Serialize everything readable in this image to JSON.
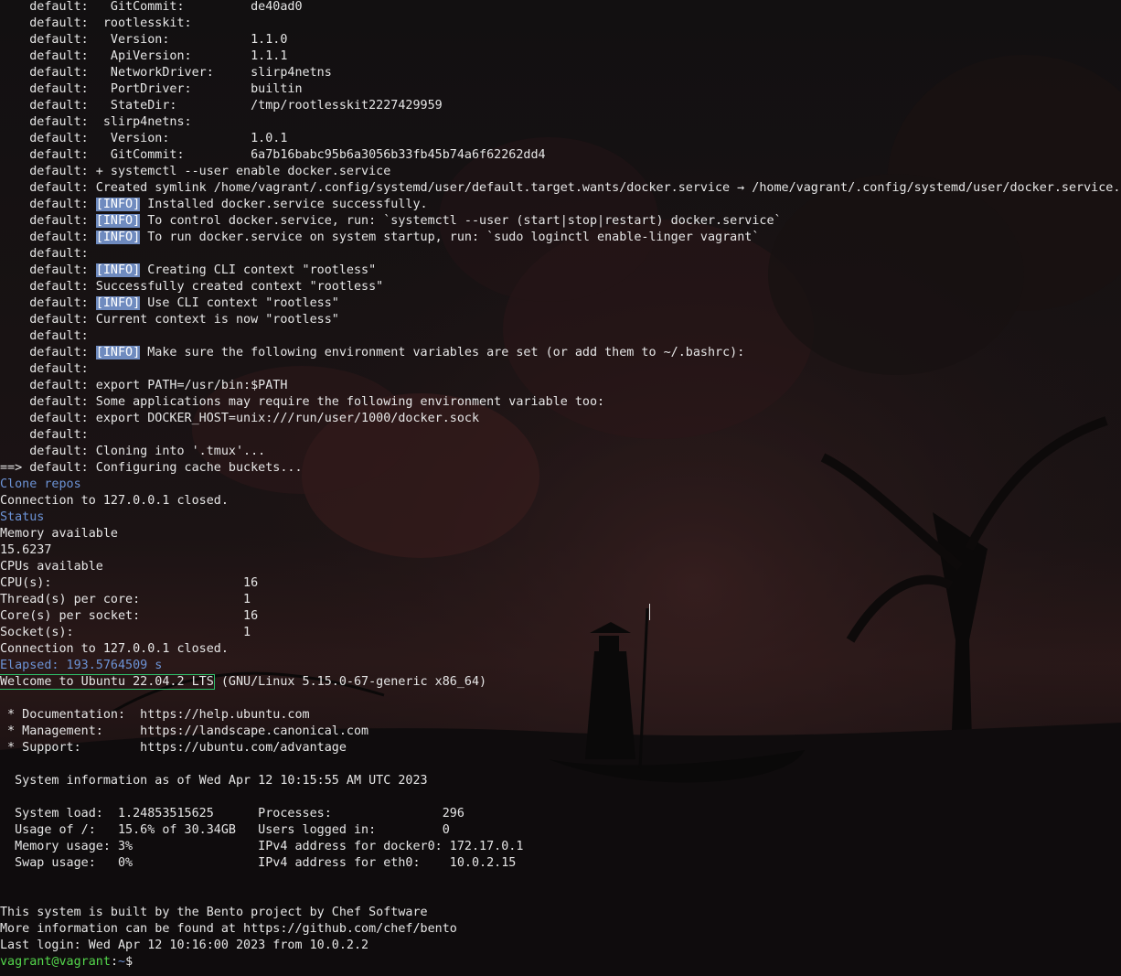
{
  "theme": {
    "foreground": "#e6e6e6",
    "accent_blue": "#6c93d6",
    "prompt_green": "#54d64c",
    "info_badge_bg": "#6f8bbf",
    "highlight_box": "#2fc16a",
    "background": "#141112"
  },
  "terminal": {
    "lines": [
      [
        {
          "t": "    default:   GitCommit:         de40ad0"
        }
      ],
      [
        {
          "t": "    default:  rootlesskit:"
        }
      ],
      [
        {
          "t": "    default:   Version:           1.1.0"
        }
      ],
      [
        {
          "t": "    default:   ApiVersion:        1.1.1"
        }
      ],
      [
        {
          "t": "    default:   NetworkDriver:     slirp4netns"
        }
      ],
      [
        {
          "t": "    default:   PortDriver:        builtin"
        }
      ],
      [
        {
          "t": "    default:   StateDir:          /tmp/rootlesskit2227429959"
        }
      ],
      [
        {
          "t": "    default:  slirp4netns:"
        }
      ],
      [
        {
          "t": "    default:   Version:           1.0.1"
        }
      ],
      [
        {
          "t": "    default:   GitCommit:         6a7b16babc95b6a3056b33fb45b74a6f62262dd4"
        }
      ],
      [
        {
          "t": "    default: + systemctl --user enable docker.service"
        }
      ],
      [
        {
          "t": "    default: Created symlink /home/vagrant/.config/systemd/user/default.target.wants/docker.service → /home/vagrant/.config/systemd/user/docker.service."
        }
      ],
      [
        {
          "t": "    default: "
        },
        {
          "t": "[INFO]",
          "s": "info"
        },
        {
          "t": " Installed docker.service successfully."
        }
      ],
      [
        {
          "t": "    default: "
        },
        {
          "t": "[INFO]",
          "s": "info"
        },
        {
          "t": " To control docker.service, run: `systemctl --user (start|stop|restart) docker.service`"
        }
      ],
      [
        {
          "t": "    default: "
        },
        {
          "t": "[INFO]",
          "s": "info"
        },
        {
          "t": " To run docker.service on system startup, run: `sudo loginctl enable-linger vagrant`"
        }
      ],
      [
        {
          "t": "    default:"
        }
      ],
      [
        {
          "t": "    default: "
        },
        {
          "t": "[INFO]",
          "s": "info"
        },
        {
          "t": " Creating CLI context \"rootless\""
        }
      ],
      [
        {
          "t": "    default: Successfully created context \"rootless\""
        }
      ],
      [
        {
          "t": "    default: "
        },
        {
          "t": "[INFO]",
          "s": "info"
        },
        {
          "t": " Use CLI context \"rootless\""
        }
      ],
      [
        {
          "t": "    default: Current context is now \"rootless\""
        }
      ],
      [
        {
          "t": "    default:"
        }
      ],
      [
        {
          "t": "    default: "
        },
        {
          "t": "[INFO]",
          "s": "info"
        },
        {
          "t": " Make sure the following environment variables are set (or add them to ~/.bashrc):"
        }
      ],
      [
        {
          "t": "    default:"
        }
      ],
      [
        {
          "t": "    default: export PATH=/usr/bin:$PATH"
        }
      ],
      [
        {
          "t": "    default: Some applications may require the following environment variable too:"
        }
      ],
      [
        {
          "t": "    default: export DOCKER_HOST=unix:///run/user/1000/docker.sock"
        }
      ],
      [
        {
          "t": "    default:"
        }
      ],
      [
        {
          "t": "    default: Cloning into '.tmux'..."
        }
      ],
      [
        {
          "t": "==> default: Configuring cache buckets..."
        }
      ],
      [
        {
          "t": "Clone repos",
          "s": "blue"
        }
      ],
      [
        {
          "t": "Connection to 127.0.0.1 closed."
        }
      ],
      [
        {
          "t": "Status",
          "s": "blue"
        }
      ],
      [
        {
          "t": "Memory available"
        }
      ],
      [
        {
          "t": "15.6237"
        }
      ],
      [
        {
          "t": "CPUs available"
        }
      ],
      [
        {
          "t": "CPU(s):                          16"
        }
      ],
      [
        {
          "t": "Thread(s) per core:              1"
        }
      ],
      [
        {
          "t": "Core(s) per socket:              16"
        }
      ],
      [
        {
          "t": "Socket(s):                       1"
        }
      ],
      [
        {
          "t": "Connection to 127.0.0.1 closed."
        }
      ],
      [
        {
          "t": "Elapsed: 193.5764509 s",
          "s": "blue"
        }
      ],
      [
        {
          "t": "Welcome to Ubuntu 22.04.2 LTS",
          "s": "boxed"
        },
        {
          "t": " (GNU/Linux 5.15.0-67-generic x86_64)"
        }
      ],
      [
        {
          "t": ""
        }
      ],
      [
        {
          "t": " * Documentation:  https://help.ubuntu.com"
        }
      ],
      [
        {
          "t": " * Management:     https://landscape.canonical.com"
        }
      ],
      [
        {
          "t": " * Support:        https://ubuntu.com/advantage"
        }
      ],
      [
        {
          "t": ""
        }
      ],
      [
        {
          "t": "  System information as of Wed Apr 12 10:15:55 AM UTC 2023"
        }
      ],
      [
        {
          "t": ""
        }
      ],
      [
        {
          "t": "  System load:  1.24853515625      Processes:               296"
        }
      ],
      [
        {
          "t": "  Usage of /:   15.6% of 30.34GB   Users logged in:         0"
        }
      ],
      [
        {
          "t": "  Memory usage: 3%                 IPv4 address for docker0: 172.17.0.1"
        }
      ],
      [
        {
          "t": "  Swap usage:   0%                 IPv4 address for eth0:    10.0.2.15"
        }
      ],
      [
        {
          "t": ""
        }
      ],
      [
        {
          "t": ""
        }
      ],
      [
        {
          "t": "This system is built by the Bento project by Chef Software"
        }
      ],
      [
        {
          "t": "More information can be found at https://github.com/chef/bento"
        }
      ],
      [
        {
          "t": "Last login: Wed Apr 12 10:16:00 2023 from 10.0.2.2"
        }
      ],
      [
        {
          "t": "vagrant@vagrant",
          "s": "green"
        },
        {
          "t": ":",
          "s": "white"
        },
        {
          "t": "~",
          "s": "blue"
        },
        {
          "t": "$ ",
          "s": "white"
        }
      ]
    ]
  }
}
